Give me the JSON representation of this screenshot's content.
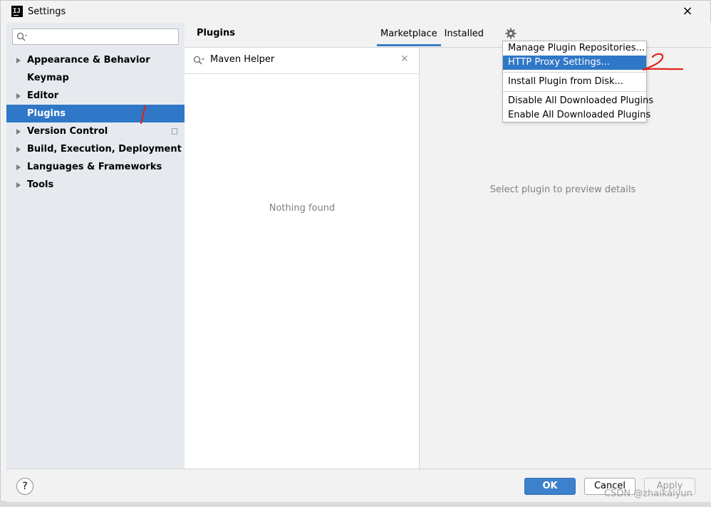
{
  "window": {
    "title": "Settings",
    "app_icon_text": "IJ"
  },
  "sidebar": {
    "search_placeholder": "",
    "items": [
      {
        "label": "Appearance & Behavior",
        "expandable": true
      },
      {
        "label": "Keymap",
        "expandable": false
      },
      {
        "label": "Editor",
        "expandable": true
      },
      {
        "label": "Plugins",
        "expandable": false,
        "selected": true
      },
      {
        "label": "Version Control",
        "expandable": true
      },
      {
        "label": "Build, Execution, Deployment",
        "expandable": true
      },
      {
        "label": "Languages & Frameworks",
        "expandable": true
      },
      {
        "label": "Tools",
        "expandable": true
      }
    ]
  },
  "main": {
    "title": "Plugins",
    "tabs": [
      {
        "label": "Marketplace",
        "active": true
      },
      {
        "label": "Installed",
        "active": false
      }
    ],
    "search_query": "Maven Helper",
    "empty_message": "Nothing found",
    "preview_hint": "Select plugin to preview details"
  },
  "menu": {
    "items": [
      {
        "label": "Manage Plugin Repositories...",
        "highlighted": false
      },
      {
        "label": "HTTP Proxy Settings...",
        "highlighted": true
      },
      {
        "label": "Install Plugin from Disk...",
        "highlighted": false
      },
      {
        "label": "Disable All Downloaded Plugins",
        "highlighted": false
      },
      {
        "label": "Enable All Downloaded Plugins",
        "highlighted": false
      }
    ]
  },
  "footer": {
    "help_label": "?",
    "ok_label": "OK",
    "cancel_label": "Cancel",
    "apply_label": "Apply"
  },
  "watermark": "CSDN @zhaikaiyun",
  "colors": {
    "selection": "#2f77c7",
    "annotation": "#e0241b",
    "ok_button": "#3d80cc"
  }
}
